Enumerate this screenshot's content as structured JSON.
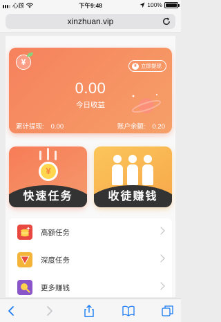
{
  "status_bar": {
    "carrier": "心顾",
    "time": "下午9:48",
    "battery_percent": "100%",
    "battery_level": 1.0
  },
  "address_bar": {
    "url": "xinzhuan.vip"
  },
  "earnings_card": {
    "withdraw_button": "立即提现",
    "today_amount": "0.00",
    "today_label": "今日收益",
    "total_withdrawn_label": "累计提现:",
    "total_withdrawn_value": "0.00",
    "balance_label": "账户余额:",
    "balance_value": "0.20",
    "badge_symbol": "¥",
    "colors": {
      "card_start": "#f6815d",
      "card_end": "#f6a068"
    }
  },
  "tiles": [
    {
      "label": "快速任务",
      "icon": "falling-coin-icon",
      "coin_symbol": "¥"
    },
    {
      "label": "收徒赚钱",
      "icon": "people-group-icon"
    }
  ],
  "menu": [
    {
      "label": "高额任务",
      "icon": "coin-stack-icon",
      "color": "#e8483f"
    },
    {
      "label": "深度任务",
      "icon": "triangle-down-icon",
      "color": "#f4b43a"
    },
    {
      "label": "更多赚钱",
      "icon": "search-coin-icon",
      "color": "#8a55c9"
    }
  ],
  "toolbar": {
    "items": [
      "back-icon",
      "forward-icon",
      "share-icon",
      "bookmarks-icon",
      "tabs-icon"
    ]
  }
}
